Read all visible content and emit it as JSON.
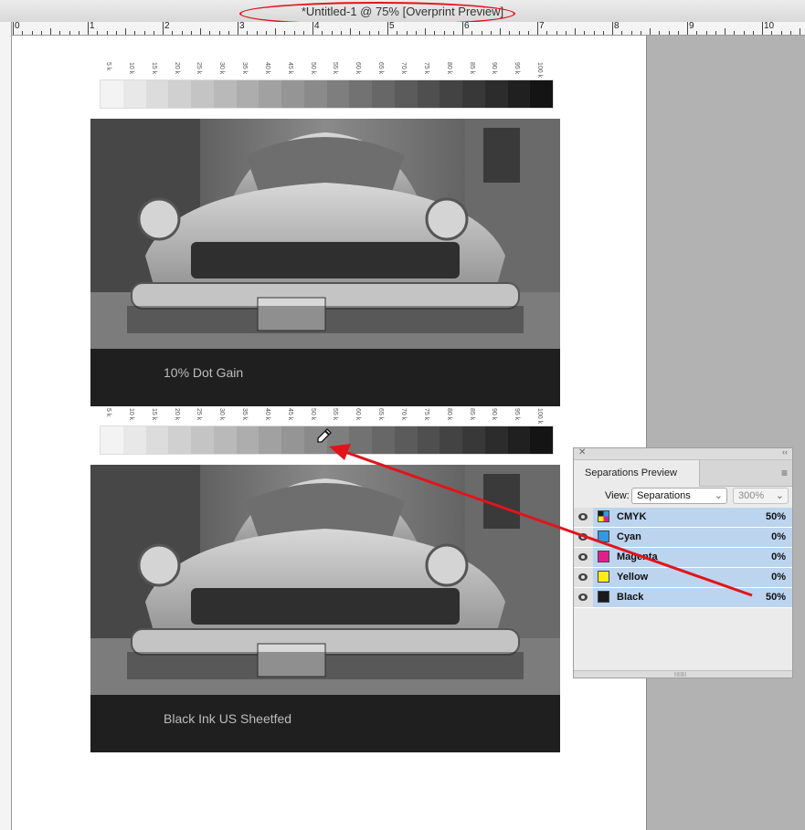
{
  "window": {
    "title": "*Untitled-1 @ 75% [Overprint Preview]"
  },
  "ruler": {
    "numbers": [
      "0",
      "1",
      "2",
      "3",
      "4",
      "5",
      "6",
      "7",
      "8",
      "9",
      "10"
    ]
  },
  "tint_strip": {
    "labels": [
      "5 k",
      "10 k",
      "15 k",
      "20 k",
      "25 k",
      "30 k",
      "35 k",
      "40 k",
      "45 k",
      "50 k",
      "55 k",
      "60 k",
      "65 k",
      "70 k",
      "75 k",
      "80 k",
      "85 k",
      "90 k",
      "95 k",
      "100 k"
    ],
    "percents": [
      5,
      10,
      15,
      20,
      25,
      30,
      35,
      40,
      45,
      50,
      55,
      60,
      65,
      70,
      75,
      80,
      85,
      90,
      95,
      100
    ]
  },
  "images": [
    {
      "caption": "10% Dot Gain"
    },
    {
      "caption": "Black Ink US Sheetfed"
    }
  ],
  "panel": {
    "title": "Separations Preview",
    "view_label": "View:",
    "view_value": "Separations",
    "zoom_value": "300%",
    "rows": [
      {
        "name": "CMYK",
        "value": "50%",
        "color": "multi"
      },
      {
        "name": "Cyan",
        "value": "0%",
        "color": "#2e9be0"
      },
      {
        "name": "Magenta",
        "value": "0%",
        "color": "#e0208a"
      },
      {
        "name": "Yellow",
        "value": "0%",
        "color": "#ffec1a"
      },
      {
        "name": "Black",
        "value": "50%",
        "color": "#1b1b1b"
      }
    ]
  },
  "colors": {
    "annotation": "#e3131b",
    "row_highlight": "#bcd4ee"
  }
}
